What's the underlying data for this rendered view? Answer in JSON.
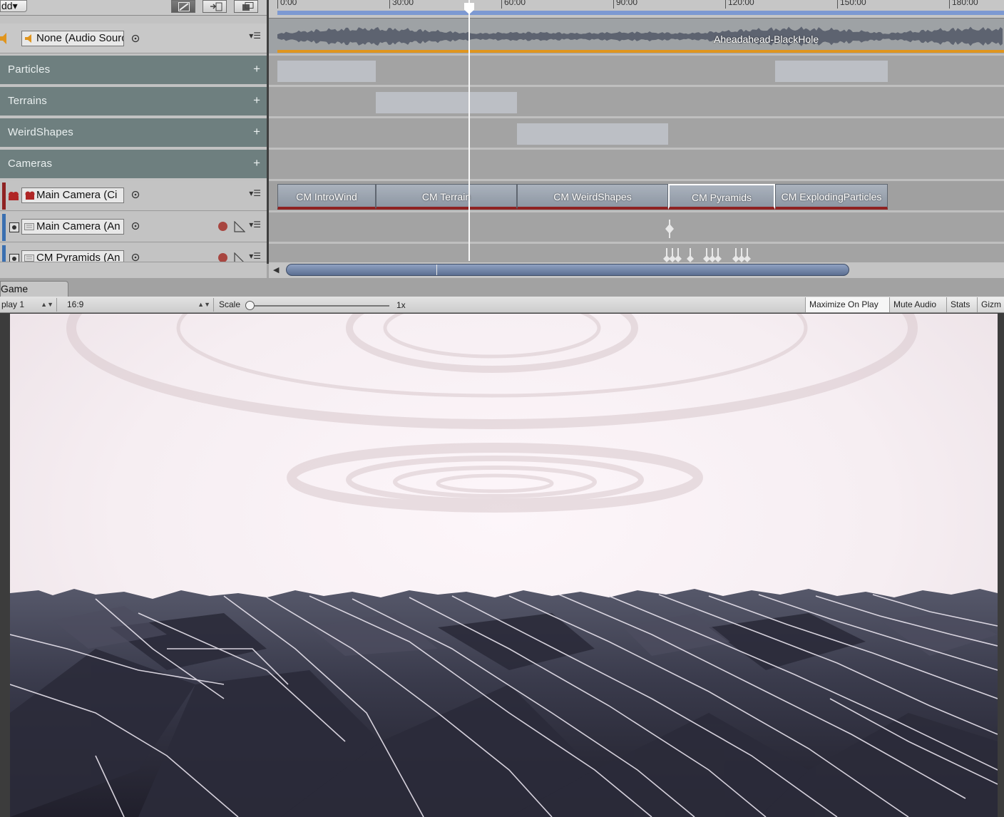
{
  "toolbar": {
    "add_label": "dd▾"
  },
  "ruler": {
    "labels": [
      "0:00",
      "30:00",
      "60:00",
      "90:00",
      "120:00",
      "150:00",
      "180:00"
    ]
  },
  "tracks": {
    "audio": {
      "object": "None (Audio Source",
      "clip": "Aheadahead-BlackHole"
    },
    "groups": [
      {
        "label": "Particles"
      },
      {
        "label": "Terrains"
      },
      {
        "label": "WeirdShapes"
      },
      {
        "label": "Cameras"
      }
    ],
    "cinemachine": {
      "object": "Main Camera (Ci"
    },
    "anim1": {
      "object": "Main Camera (An"
    },
    "anim2": {
      "object": "CM Pyramids (An"
    }
  },
  "camera_clips": [
    "CM IntroWind",
    "CM Terrain",
    "CM WeirdShapes",
    "CM Pyramids",
    "CM ExplodingParticles"
  ],
  "game": {
    "tab_label": "Game",
    "display": "play 1",
    "aspect": "16:9",
    "scale_label": "Scale",
    "scale_value": "1x",
    "scale": 0.0,
    "buttons": [
      "Maximize On Play",
      "Mute Audio",
      "Stats",
      "Gizm"
    ]
  },
  "colors": {
    "group_bg": "#6e7f7f",
    "audio_accent": "#e0951e",
    "clip_underline": "#8f2222",
    "ruler_blue": "#7d99d2",
    "scroll_thumb": "#5c6f92"
  }
}
